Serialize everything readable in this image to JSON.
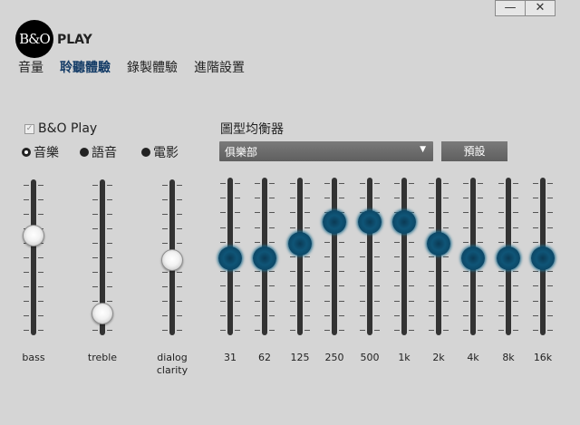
{
  "window": {
    "minimize_label": "—",
    "close_label": "✕"
  },
  "logo": {
    "mark": "B&O",
    "text": "PLAY"
  },
  "tabs": [
    {
      "label": "音量",
      "active": false
    },
    {
      "label": "聆聽體驗",
      "active": true
    },
    {
      "label": "錄製體驗",
      "active": false
    },
    {
      "label": "進階設置",
      "active": false
    }
  ],
  "bo_play": {
    "label": "B&O Play",
    "checked": true
  },
  "modes": [
    {
      "label": "音樂",
      "selected": true
    },
    {
      "label": "語音",
      "selected": false
    },
    {
      "label": "電影",
      "selected": false
    }
  ],
  "tone_sliders": [
    {
      "label": "bass",
      "level": 0.64
    },
    {
      "label": "treble",
      "level": 0.14
    },
    {
      "label": "dialog\nclarity",
      "level": 0.48
    }
  ],
  "equalizer": {
    "title": "圖型均衡器",
    "preset_value": "俱樂部",
    "preset_button": "預設",
    "bands": [
      {
        "label": "31",
        "level": 0.49
      },
      {
        "label": "62",
        "level": 0.49
      },
      {
        "label": "125",
        "level": 0.58
      },
      {
        "label": "250",
        "level": 0.72
      },
      {
        "label": "500",
        "level": 0.72
      },
      {
        "label": "1k",
        "level": 0.72
      },
      {
        "label": "2k",
        "level": 0.58
      },
      {
        "label": "4k",
        "level": 0.49
      },
      {
        "label": "8k",
        "level": 0.49
      },
      {
        "label": "16k",
        "level": 0.49
      }
    ]
  },
  "colors": {
    "accent": "#133b66",
    "knob_blue": "#0f5577"
  }
}
